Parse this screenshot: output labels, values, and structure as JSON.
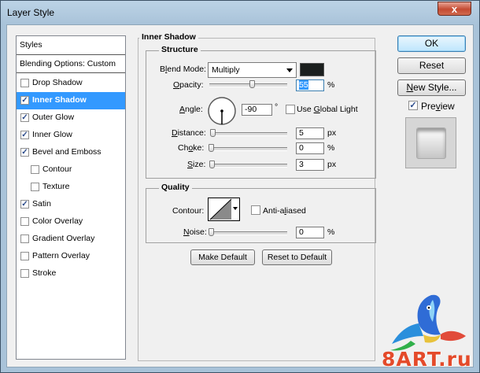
{
  "window": {
    "title": "Layer Style",
    "close_label": "x"
  },
  "styles_panel": {
    "header": "Styles",
    "blending": "Blending Options: Custom",
    "items": [
      {
        "label": "Drop Shadow",
        "checked": false,
        "indent": false,
        "selected": false
      },
      {
        "label": "Inner Shadow",
        "checked": true,
        "indent": false,
        "selected": true
      },
      {
        "label": "Outer Glow",
        "checked": true,
        "indent": false,
        "selected": false
      },
      {
        "label": "Inner Glow",
        "checked": true,
        "indent": false,
        "selected": false
      },
      {
        "label": "Bevel and Emboss",
        "checked": true,
        "indent": false,
        "selected": false
      },
      {
        "label": "Contour",
        "checked": false,
        "indent": true,
        "selected": false
      },
      {
        "label": "Texture",
        "checked": false,
        "indent": true,
        "selected": false
      },
      {
        "label": "Satin",
        "checked": true,
        "indent": false,
        "selected": false
      },
      {
        "label": "Color Overlay",
        "checked": false,
        "indent": false,
        "selected": false
      },
      {
        "label": "Gradient Overlay",
        "checked": false,
        "indent": false,
        "selected": false
      },
      {
        "label": "Pattern Overlay",
        "checked": false,
        "indent": false,
        "selected": false
      },
      {
        "label": "Stroke",
        "checked": false,
        "indent": false,
        "selected": false
      }
    ]
  },
  "inner_shadow": {
    "title": "Inner Shadow",
    "structure": {
      "title": "Structure",
      "blend_mode_label_pre": "B",
      "blend_mode_label_u": "l",
      "blend_mode_label_post": "end Mode:",
      "blend_mode_value": "Multiply",
      "shadow_color": "#1b1f1e",
      "opacity_label_u": "O",
      "opacity_label_post": "pacity:",
      "opacity_value": "55",
      "opacity_unit": "%",
      "opacity_level": 0.55,
      "angle_label_u": "A",
      "angle_label_post": "ngle:",
      "angle_value": "-90",
      "angle_unit": "°",
      "global_light_pre": "Use ",
      "global_light_u": "G",
      "global_light_post": "lobal Light",
      "global_light_checked": false,
      "distance_label_u": "D",
      "distance_label_post": "istance:",
      "distance_value": "5",
      "distance_unit": "px",
      "distance_level": 0.02,
      "choke_label_pre": "Ch",
      "choke_label_u": "o",
      "choke_label_post": "ke:",
      "choke_value": "0",
      "choke_unit": "%",
      "choke_level": 0.0,
      "size_label_u": "S",
      "size_label_post": "ize:",
      "size_value": "3",
      "size_unit": "px",
      "size_level": 0.01
    },
    "quality": {
      "title": "Quality",
      "contour_label": "Contour:",
      "anti_aliased_pre": "Anti-a",
      "anti_aliased_u": "l",
      "anti_aliased_post": "iased",
      "anti_aliased_checked": false,
      "noise_label_u": "N",
      "noise_label_post": "oise:",
      "noise_value": "0",
      "noise_unit": "%",
      "noise_level": 0.0
    },
    "make_default": "Make Default",
    "reset_default": "Reset to Default"
  },
  "buttons": {
    "ok": "OK",
    "reset": "Reset",
    "new_style_u": "N",
    "new_style_post": "ew Style...",
    "preview_pre": "Pre",
    "preview_u": "v",
    "preview_post": "iew",
    "preview_checked": true
  },
  "watermark": {
    "text": "8ART.ru"
  },
  "colors": {
    "selection": "#3399ff",
    "accent": "#3c7fb1"
  }
}
